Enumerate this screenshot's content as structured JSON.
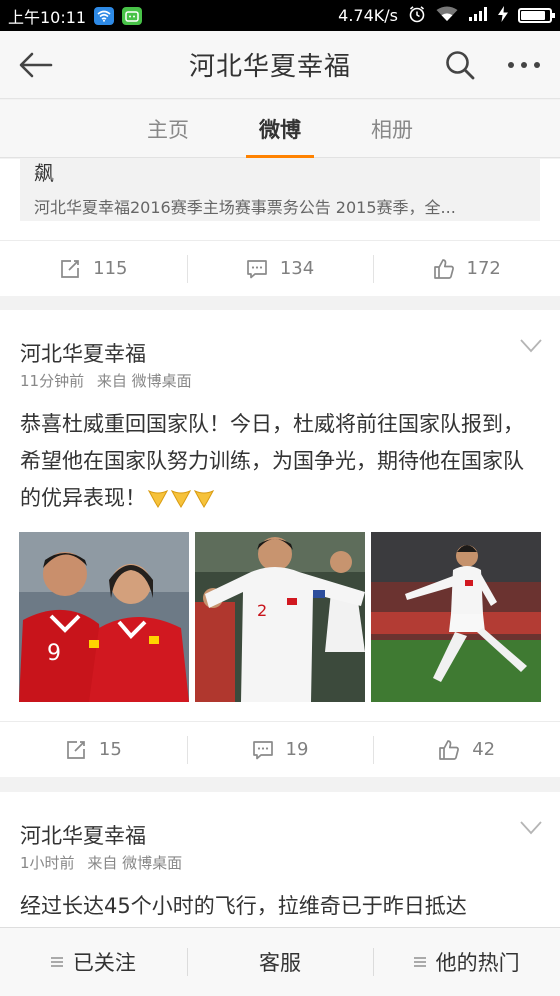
{
  "status_bar": {
    "time": "上午10:11",
    "speed": "4.74K/s"
  },
  "header": {
    "title": "河北华夏幸福"
  },
  "tabs": [
    {
      "label": "主页",
      "active": false
    },
    {
      "label": "微博",
      "active": true
    },
    {
      "label": "相册",
      "active": false
    }
  ],
  "post1": {
    "quote_title": "飙",
    "quote_text": "河北华夏幸福2016赛季主场赛事票务公告 2015赛季，全...",
    "reposts": "115",
    "comments": "134",
    "likes": "172"
  },
  "post2": {
    "author": "河北华夏幸福",
    "time": "11分钟前",
    "source": "来自 微博桌面",
    "text": "恭喜杜威重回国家队！今日，杜威将前往国家队报到，希望他在国家队努力训练，为国争光，期待他在国家队的优异表现！",
    "reposts": "15",
    "comments": "19",
    "likes": "42"
  },
  "post3": {
    "author": "河北华夏幸福",
    "time": "1小时前",
    "source": "来自 微博桌面",
    "text": "经过长达45个小时的飞行，拉维奇已于昨日抵达"
  },
  "bottom_bar": {
    "following": "已关注",
    "service": "客服",
    "hot": "他的热门"
  },
  "colors": {
    "accent": "#ff8200"
  }
}
